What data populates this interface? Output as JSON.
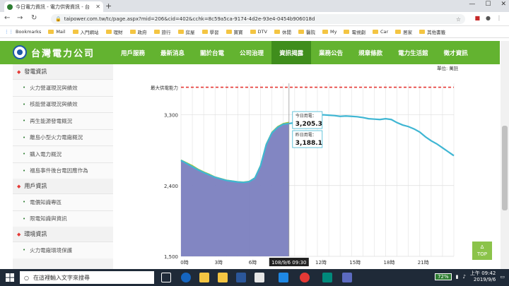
{
  "browser": {
    "tab_title": "今日電力資訊 - 電力供需資訊 - 台",
    "url": "taipower.com.tw/tc/page.aspx?mid=206&cid=402&cchk=8c59a5ca-9174-4d2e-93e4-0454b906018d",
    "bookmarks": [
      "Bookmarks",
      "Mail",
      "入門網站",
      "理財",
      "政府",
      "旅行",
      "房屋",
      "學習",
      "寶寶",
      "DTV",
      "休閒",
      "醫院",
      "My",
      "電視劇",
      "Car",
      "居家",
      "其他書籤"
    ]
  },
  "site": {
    "logo_text": "台灣電力公司",
    "nav": [
      "用戶服務",
      "最新消息",
      "關於台電",
      "公司治理",
      "資訊揭露",
      "業務公告",
      "規章條款",
      "電力生活館",
      "徵才資訊"
    ],
    "active_nav": 4
  },
  "sidebar": {
    "sections": [
      {
        "title": "發電資訊",
        "items": [
          "火力營運現況與績效",
          "核能營運現況與績效",
          "再生能源發電概況",
          "離島小型火力電廠概況",
          "購入電力概況",
          "福島事件後台電因應作為"
        ]
      },
      {
        "title": "用戶資訊",
        "items": [
          "電價知識專區",
          "限電知識與資訊"
        ]
      },
      {
        "title": "環境資訊",
        "items": [
          "火力電廠環境保護"
        ]
      }
    ]
  },
  "unit_label": "單位: 萬瓩",
  "top_button": {
    "arrow": "Δ",
    "label": "TOP"
  },
  "taskbar": {
    "search_placeholder": "在這裡輸入文字來搜尋",
    "battery": "72%",
    "time": "09:42",
    "period": "上午",
    "date": "2019/9/6"
  },
  "chart_data": {
    "type": "line",
    "max_capacity_label": "最大供電能力",
    "max_capacity": 3650,
    "ylim": [
      1500,
      3700
    ],
    "yticks": [
      1500,
      2400,
      3300
    ],
    "ytick_labels": [
      "1,500",
      "2,400",
      "3,300"
    ],
    "xlim": [
      0,
      24
    ],
    "xticks": [
      0,
      3,
      6,
      12,
      15,
      18,
      21
    ],
    "xtick_labels": [
      "0時",
      "3時",
      "6時",
      "12時",
      "15時",
      "18時",
      "21時"
    ],
    "cursor_label": "108/9/6 09:30",
    "cursor_x": 9.5,
    "tooltip": {
      "today_label": "今日用電：",
      "today_value": "3,205.3",
      "yesterday_label": "昨日用電：",
      "yesterday_value": "3,188.1"
    },
    "colors": {
      "today_fill": "#7b7fbf",
      "yesterday_line": "#3fb6d3",
      "max_line": "#e53935",
      "today_line": "#a4c639"
    },
    "series": [
      {
        "name": "今日用電",
        "x": [
          0,
          0.5,
          1,
          1.5,
          2,
          2.5,
          3,
          3.5,
          4,
          4.5,
          5,
          5.5,
          6,
          6.5,
          7,
          7.5,
          8,
          8.5,
          9,
          9.5
        ],
        "values": [
          2725,
          2690,
          2655,
          2610,
          2575,
          2545,
          2510,
          2490,
          2470,
          2460,
          2450,
          2445,
          2455,
          2500,
          2660,
          2930,
          3080,
          3150,
          3190,
          3205
        ]
      },
      {
        "name": "昨日用電",
        "x": [
          0,
          0.5,
          1,
          1.5,
          2,
          2.5,
          3,
          3.5,
          4,
          4.5,
          5,
          5.5,
          6,
          6.5,
          7,
          7.5,
          8,
          8.5,
          9,
          9.5,
          10,
          10.5,
          11,
          11.5,
          12,
          12.5,
          13,
          13.5,
          14,
          14.5,
          15,
          15.5,
          16,
          16.5,
          17,
          17.5,
          18,
          18.5,
          19,
          19.5,
          20,
          20.5,
          21,
          21.5,
          22,
          22.5,
          23,
          23.5,
          24
        ],
        "values": [
          2720,
          2680,
          2640,
          2600,
          2565,
          2535,
          2505,
          2485,
          2465,
          2455,
          2445,
          2440,
          2450,
          2495,
          2650,
          2920,
          3070,
          3140,
          3180,
          3188,
          3200,
          3230,
          3220,
          3210,
          3290,
          3300,
          3295,
          3290,
          3280,
          3285,
          3280,
          3275,
          3265,
          3250,
          3245,
          3240,
          3250,
          3240,
          3200,
          3170,
          3150,
          3120,
          3080,
          3020,
          2970,
          2930,
          2880,
          2830,
          2780
        ]
      }
    ]
  }
}
